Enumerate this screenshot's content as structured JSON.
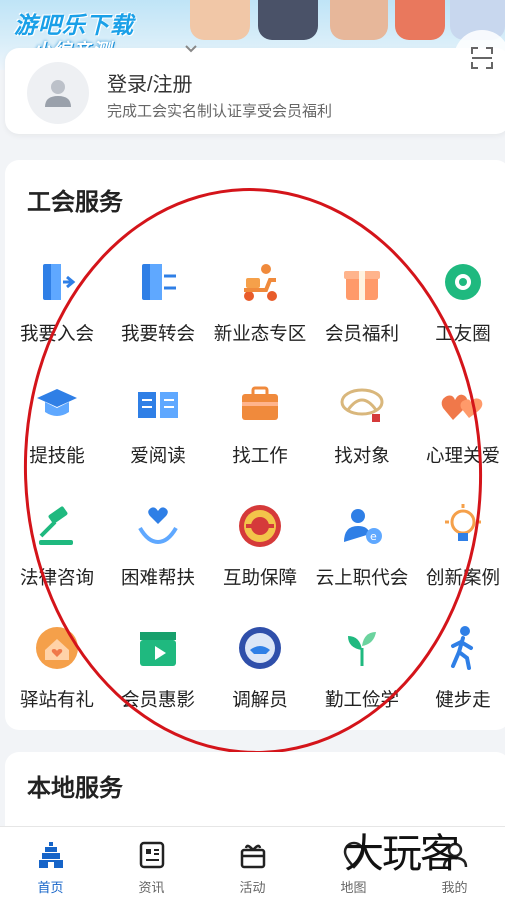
{
  "watermark": {
    "line1": "游吧乐下载",
    "line2": "小编亲测",
    "bottom": "大玩客"
  },
  "login": {
    "title": "登录/注册",
    "subtitle": "完成工会实名制认证享受会员福利"
  },
  "union_services": {
    "title": "工会服务",
    "items": [
      {
        "label": "我要入会",
        "icon": "door-enter-icon"
      },
      {
        "label": "我要转会",
        "icon": "door-transfer-icon"
      },
      {
        "label": "新业态专区",
        "icon": "delivery-scooter-icon"
      },
      {
        "label": "会员福利",
        "icon": "gift-box-icon"
      },
      {
        "label": "工友圈",
        "icon": "camera-aperture-icon"
      },
      {
        "label": "提技能",
        "icon": "graduation-cap-icon"
      },
      {
        "label": "爱阅读",
        "icon": "open-book-icon"
      },
      {
        "label": "找工作",
        "icon": "briefcase-icon"
      },
      {
        "label": "找对象",
        "icon": "love-knot-icon"
      },
      {
        "label": "心理关爱",
        "icon": "hearts-icon"
      },
      {
        "label": "法律咨询",
        "icon": "gavel-icon"
      },
      {
        "label": "困难帮扶",
        "icon": "helping-hands-icon"
      },
      {
        "label": "互助保障",
        "icon": "union-emblem-icon"
      },
      {
        "label": "云上职代会",
        "icon": "user-network-icon"
      },
      {
        "label": "创新案例",
        "icon": "lightbulb-icon"
      },
      {
        "label": "驿站有礼",
        "icon": "house-heart-icon"
      },
      {
        "label": "会员惠影",
        "icon": "film-clapper-icon"
      },
      {
        "label": "调解员",
        "icon": "mediation-badge-icon"
      },
      {
        "label": "勤工俭学",
        "icon": "sprout-icon"
      },
      {
        "label": "健步走",
        "icon": "walking-person-icon"
      }
    ]
  },
  "local_services": {
    "title": "本地服务"
  },
  "bottom_nav": [
    {
      "label": "首页",
      "icon": "home-tower-icon",
      "active": true
    },
    {
      "label": "资讯",
      "icon": "news-icon",
      "active": false
    },
    {
      "label": "活动",
      "icon": "activity-gift-icon",
      "active": false
    },
    {
      "label": "地图",
      "icon": "map-icon",
      "active": false
    },
    {
      "label": "我的",
      "icon": "profile-icon",
      "active": false
    }
  ],
  "colors": {
    "accent": "#1664c8",
    "annotation": "#d4141a",
    "background": "#f2f4f7"
  }
}
